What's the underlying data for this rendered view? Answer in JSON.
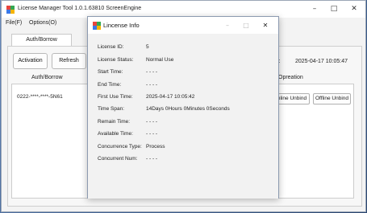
{
  "app": {
    "title": "License Manager Tool 1.0.1.63810  ScreenEngine"
  },
  "menu": [
    {
      "label": "File(F)"
    },
    {
      "label": "Options(O)"
    }
  ],
  "tabs": [
    {
      "label": "Auth/Borrow"
    }
  ],
  "toolbar": {
    "activation_label": "Activation",
    "refresh_label": "Refresh"
  },
  "time_panel": {
    "label_fragment": "l:",
    "value": "2025-04-17 10:05:47"
  },
  "list": {
    "header_auth": "Auth/Borrow",
    "header_operation": "Opreation",
    "rows": [
      {
        "license": "0222-****-****-5N61",
        "online_unbind": "nline Unbind",
        "offline_unbind": "Offline Unbind"
      }
    ]
  },
  "dialog": {
    "title": "Lincense Info",
    "fields": [
      {
        "label": "License ID:",
        "value": "5"
      },
      {
        "label": "License Status:",
        "value": "Normal Use"
      },
      {
        "label": "Start Time:",
        "value": "- - - -"
      },
      {
        "label": "End Time:",
        "value": "- - - -"
      },
      {
        "label": "First Use Time:",
        "value": "2025-04-17 10:05:42"
      },
      {
        "label": "Time Span:",
        "value": "14Days 0Hours 0Minutes 0Seconds"
      },
      {
        "label": "Remain Time:",
        "value": "- - - -"
      },
      {
        "label": "Available Time:",
        "value": "- - - -"
      },
      {
        "label": "Concurrence Type:",
        "value": "Process"
      },
      {
        "label": "Concurrent Num:",
        "value": "- - - -"
      }
    ]
  },
  "icons": {
    "window_minimize": "minimize-icon",
    "window_maximize": "maximize-icon",
    "window_close": "close-icon",
    "app_logo": "app-logo-icon"
  },
  "colors": {
    "logo_red": "#e8453c",
    "logo_green": "#34a853",
    "logo_blue": "#3b78e7",
    "logo_yellow": "#f5b400"
  }
}
